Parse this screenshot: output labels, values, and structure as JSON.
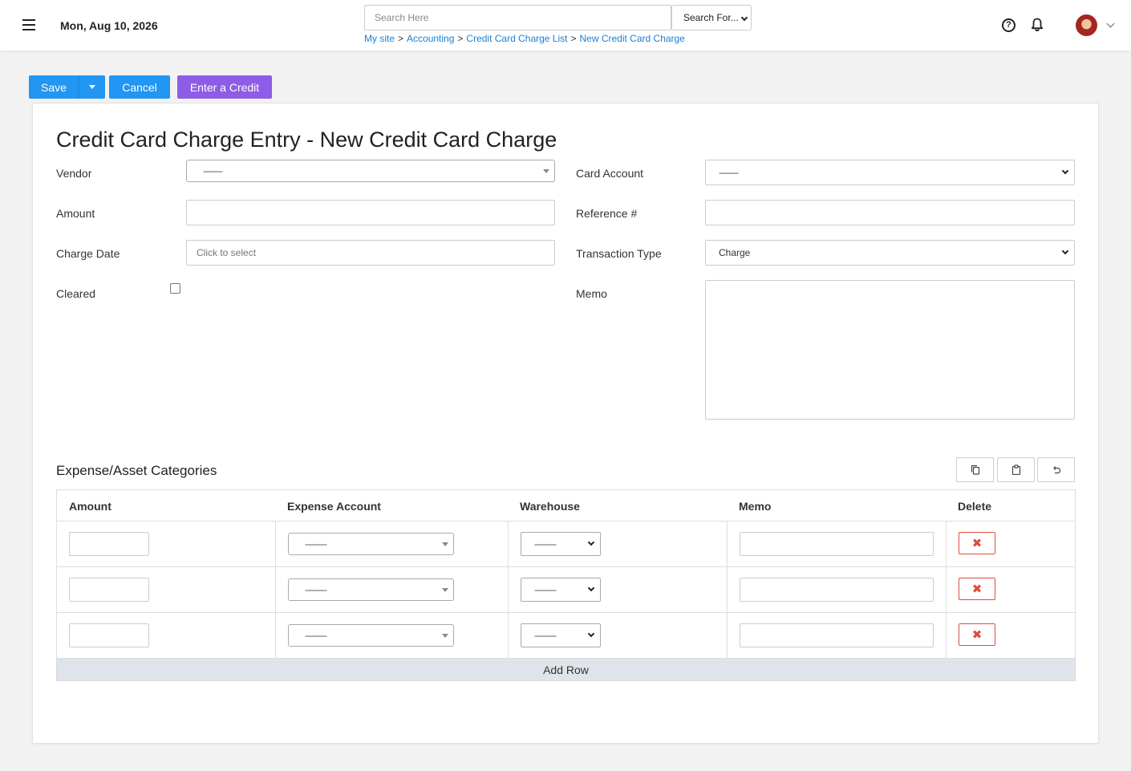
{
  "header": {
    "date": "Mon, Aug 10, 2026",
    "search_placeholder": "Search Here",
    "search_for": "Search For...",
    "breadcrumb": [
      "My site",
      "Accounting",
      "Credit Card Charge List",
      "New Credit Card Charge"
    ],
    "breadcrumb_sep": ">"
  },
  "actions": {
    "save": "Save",
    "cancel": "Cancel",
    "enter_credit": "Enter a Credit"
  },
  "form": {
    "title": "Credit Card Charge Entry - New Credit Card Charge",
    "vendor_label": "Vendor",
    "vendor_value": "--------",
    "amount_label": "Amount",
    "amount_value": "",
    "charge_date_label": "Charge Date",
    "charge_date_placeholder": "Click to select",
    "cleared_label": "Cleared",
    "cleared_checked": false,
    "card_account_label": "Card Account",
    "card_account_value": "--------",
    "reference_label": "Reference #",
    "reference_value": "",
    "transaction_type_label": "Transaction Type",
    "transaction_type_value": "Charge",
    "memo_label": "Memo",
    "memo_value": ""
  },
  "categories": {
    "title": "Expense/Asset Categories",
    "tools": [
      "copy-icon",
      "clipboard-icon",
      "undo-icon"
    ],
    "columns": [
      "Amount",
      "Expense Account",
      "Warehouse",
      "Memo",
      "Delete"
    ],
    "rows": [
      {
        "amount": "",
        "expense_account": "---------",
        "warehouse": "---------",
        "memo": ""
      },
      {
        "amount": "",
        "expense_account": "---------",
        "warehouse": "---------",
        "memo": ""
      },
      {
        "amount": "",
        "expense_account": "---------",
        "warehouse": "---------",
        "memo": ""
      }
    ],
    "add_row": "Add Row"
  },
  "colors": {
    "primary": "#2196f3",
    "credit": "#8e5ce6",
    "danger": "#e04b3f",
    "link": "#1a7fd4"
  }
}
